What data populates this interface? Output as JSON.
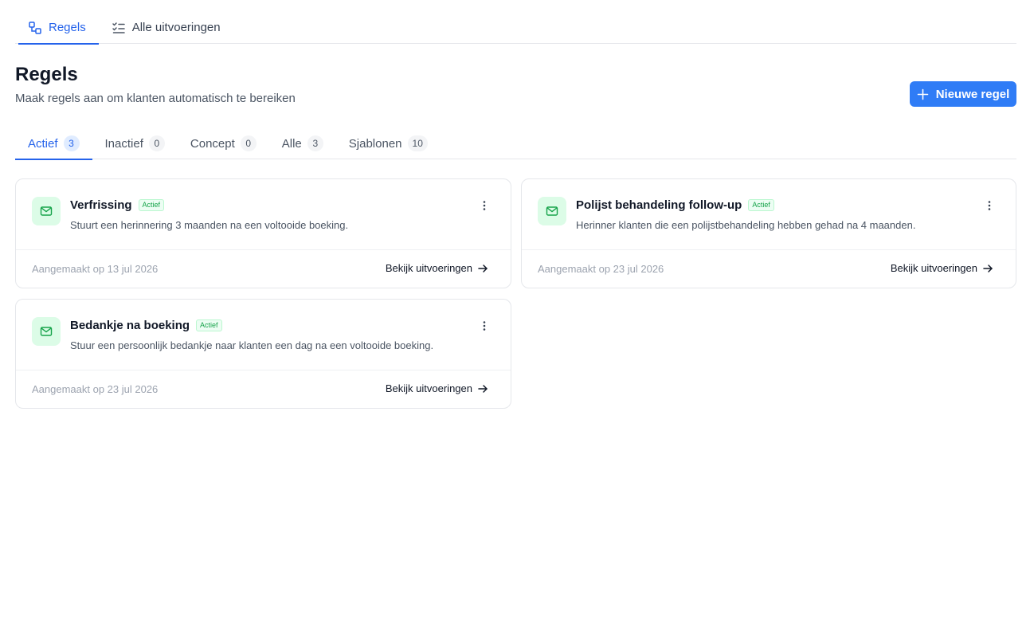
{
  "top_nav": {
    "tabs": [
      {
        "label": "Regels",
        "icon": "workflow-icon",
        "active": true
      },
      {
        "label": "Alle uitvoeringen",
        "icon": "checklist-icon",
        "active": false
      }
    ]
  },
  "header": {
    "title": "Regels",
    "subtitle": "Maak regels aan om klanten automatisch te bereiken",
    "new_button_label": "Nieuwe regel"
  },
  "filter_tabs": [
    {
      "label": "Actief",
      "count": "3",
      "active": true
    },
    {
      "label": "Inactief",
      "count": "0",
      "active": false
    },
    {
      "label": "Concept",
      "count": "0",
      "active": false
    },
    {
      "label": "Alle",
      "count": "3",
      "active": false
    },
    {
      "label": "Sjablonen",
      "count": "10",
      "active": false
    }
  ],
  "rules": [
    {
      "title": "Verfrissing",
      "status": "Actief",
      "description": "Stuurt een herinnering 3 maanden na een voltooide boeking.",
      "created": "Aangemaakt op 13 jul 2026",
      "link_label": "Bekijk uitvoeringen",
      "icon": "mail-icon"
    },
    {
      "title": "Polijst behandeling follow-up",
      "status": "Actief",
      "description": "Herinner klanten die een polijstbehandeling hebben gehad na 4 maanden.",
      "created": "Aangemaakt op 23 jul 2026",
      "link_label": "Bekijk uitvoeringen",
      "icon": "mail-icon"
    },
    {
      "title": "Bedankje na boeking",
      "status": "Actief",
      "description": "Stuur een persoonlijk bedankje naar klanten een dag na een voltooide boeking.",
      "created": "Aangemaakt op 23 jul 2026",
      "link_label": "Bekijk uitvoeringen",
      "icon": "mail-icon"
    }
  ],
  "colors": {
    "accent": "#2f7cf6",
    "active_tab": "#2563eb",
    "icon_bg": "#dcfce7",
    "icon_fg": "#16a34a",
    "badge_text": "#16a34a"
  }
}
